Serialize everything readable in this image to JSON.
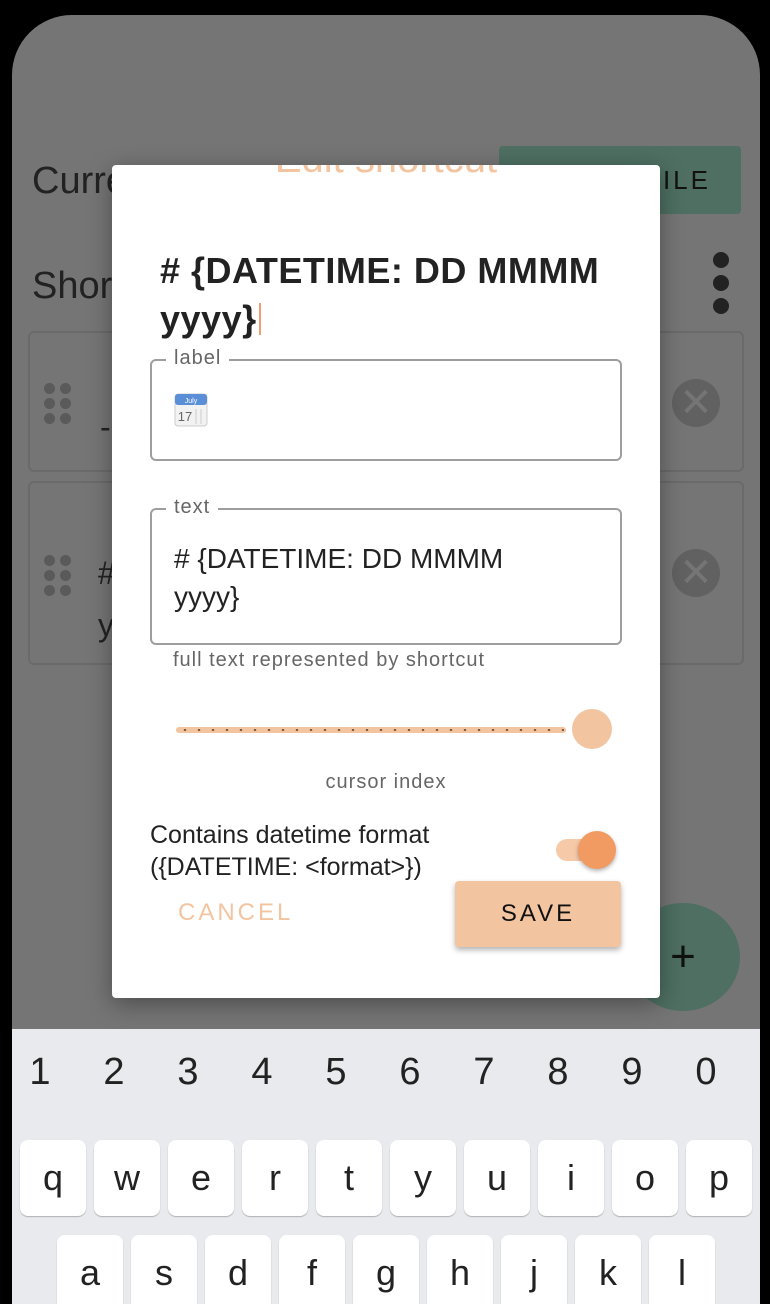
{
  "background": {
    "current_label": "Curre",
    "file_button": "FILE",
    "shortcuts_label": "Shor",
    "card1_text": "-",
    "card2_text_a": "#",
    "card2_text_b": "y",
    "fab_label": "+"
  },
  "dialog": {
    "title": "Edit shortcut",
    "preview_text": "# {DATETIME: DD MMMM yyyy}",
    "label_field": {
      "legend": "label",
      "value_icon": "calendar-icon"
    },
    "text_field": {
      "legend": "text",
      "value_line1": "# {DATETIME: DD MMMM",
      "value_line2": "yyyy}"
    },
    "helper_text": "full text represented by shortcut",
    "cursor_slider": {
      "label": "cursor index",
      "value_fraction": 1.0
    },
    "datetime_toggle": {
      "label_line1": "Contains datetime format",
      "label_line2": "({DATETIME: <format>})",
      "checked": true
    },
    "cancel_label": "CANCEL",
    "save_label": "SAVE"
  },
  "calendar_icon": {
    "month": "July",
    "day": "17"
  },
  "keyboard": {
    "numbers": [
      "1",
      "2",
      "3",
      "4",
      "5",
      "6",
      "7",
      "8",
      "9",
      "0"
    ],
    "row1": [
      "q",
      "w",
      "e",
      "r",
      "t",
      "y",
      "u",
      "i",
      "o",
      "p"
    ],
    "row2": [
      "a",
      "s",
      "d",
      "f",
      "g",
      "h",
      "j",
      "k",
      "l"
    ]
  },
  "colors": {
    "accent": "#f3c4a0",
    "accent_dark": "#f19a62",
    "scrim": "#757575",
    "keyboard_bg": "#e8eaed"
  }
}
